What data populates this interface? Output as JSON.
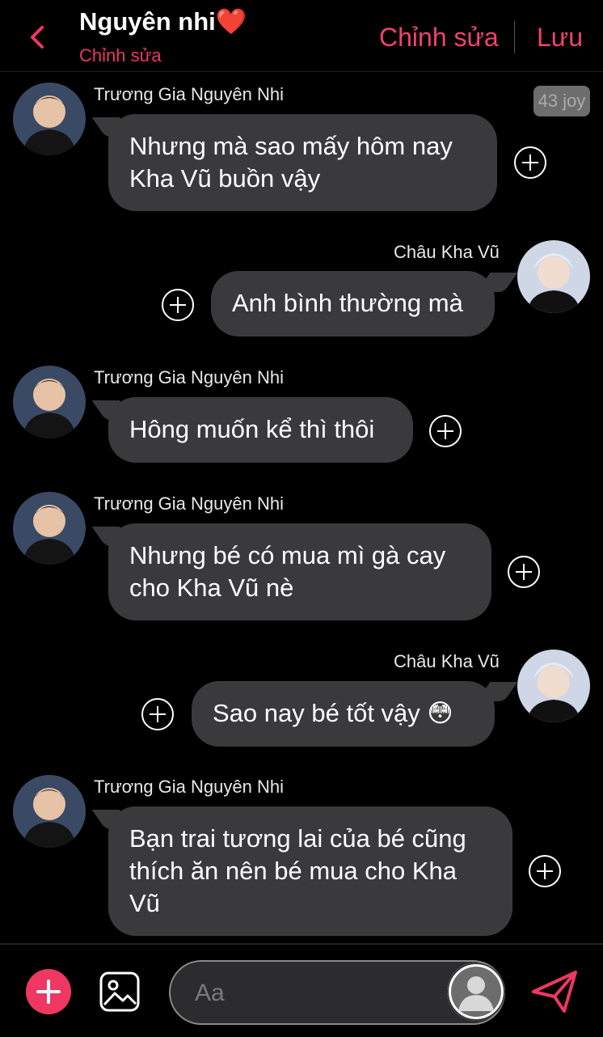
{
  "header": {
    "title": "Nguyên nhi",
    "title_emoji": "❤️",
    "subtitle": "Chỉnh sửa",
    "edit_label": "Chỉnh sửa",
    "save_label": "Lưu"
  },
  "badge": "43 joy",
  "messages": [
    {
      "sender": "Trương Gia Nguyên Nhi",
      "text": "Nhưng mà sao mấy hôm nay Kha Vũ buồn vậy",
      "dir": "in"
    },
    {
      "sender": "Châu Kha Vũ",
      "text": "Anh bình thường mà",
      "dir": "out"
    },
    {
      "sender": "Trương Gia Nguyên Nhi",
      "text": "Hông muốn kể thì thôi",
      "dir": "in"
    },
    {
      "sender": "Trương Gia Nguyên Nhi",
      "text": "Nhưng bé có mua mì gà cay cho Kha Vũ nè",
      "dir": "in"
    },
    {
      "sender": "Châu Kha Vũ",
      "text": "Sao nay bé tốt vậy 😳",
      "dir": "out"
    },
    {
      "sender": "Trương Gia Nguyên Nhi",
      "text": "Bạn trai tương lai của bé cũng thích ăn nên bé mua cho Kha Vũ",
      "dir": "in"
    }
  ],
  "composer": {
    "placeholder": "Aa"
  },
  "colors": {
    "accent": "#ee3763",
    "bubble": "#3a3a3c",
    "background": "#000000"
  },
  "icons": {
    "back": "chevron-left-icon",
    "add": "plus-icon",
    "image": "image-icon",
    "send": "send-icon",
    "bubble_action": "plus-circle-icon"
  }
}
